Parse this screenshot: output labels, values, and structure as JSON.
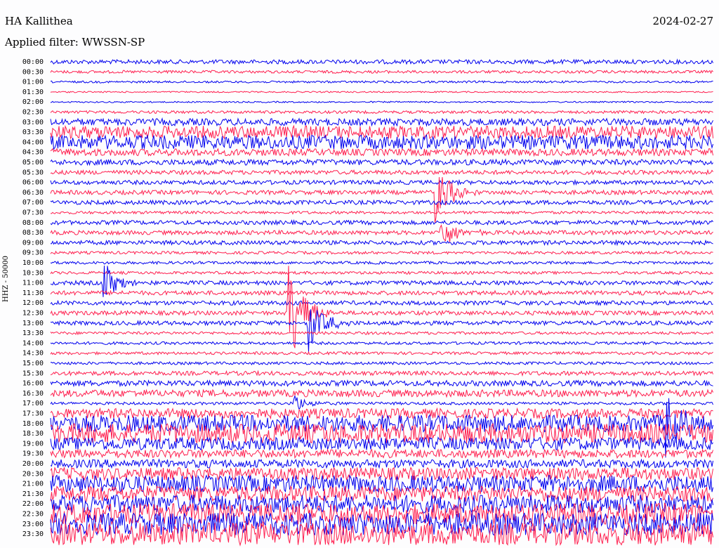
{
  "header": {
    "station": "HA Kallithea",
    "date": "2024-02-27",
    "filter": "Applied filter: WWSSN-SP"
  },
  "side_label": "HHZ - 50000",
  "colors": {
    "odd": "#0000ee",
    "even": "#ff1f4f"
  },
  "chart_data": {
    "type": "line",
    "title": "HA Kallithea",
    "subtitle": "Applied filter: WWSSN-SP",
    "ylabel": "HHZ - 50000",
    "categories": [
      "00:00",
      "00:30",
      "01:00",
      "01:30",
      "02:00",
      "02:30",
      "03:00",
      "03:30",
      "04:00",
      "04:30",
      "05:00",
      "05:30",
      "06:00",
      "06:30",
      "07:00",
      "07:30",
      "08:00",
      "08:30",
      "09:00",
      "09:30",
      "10:00",
      "10:30",
      "11:00",
      "11:30",
      "12:00",
      "12:30",
      "13:00",
      "13:30",
      "14:00",
      "14:30",
      "15:00",
      "15:30",
      "16:00",
      "16:30",
      "17:00",
      "17:30",
      "18:00",
      "18:30",
      "19:00",
      "19:30",
      "20:00",
      "20:30",
      "21:00",
      "21:30",
      "22:00",
      "22:30",
      "23:00",
      "23:30"
    ],
    "noise_level": [
      3,
      2,
      1.5,
      1,
      1,
      2,
      5,
      9,
      10,
      5,
      4,
      3,
      3,
      3,
      3,
      2,
      3,
      3,
      3,
      2,
      2,
      2,
      3,
      3,
      3,
      3,
      3,
      2,
      2,
      2,
      2,
      3,
      4,
      5,
      2,
      7,
      12,
      14,
      9,
      6,
      6,
      9,
      12,
      11,
      13,
      15,
      16,
      16
    ],
    "events": [
      {
        "row": 13,
        "pos": 0.58,
        "amp": 45
      },
      {
        "row": 17,
        "pos": 0.59,
        "amp": 25
      },
      {
        "row": 25,
        "pos": 0.36,
        "amp": 80
      },
      {
        "row": 26,
        "pos": 0.39,
        "amp": 40
      },
      {
        "row": 22,
        "pos": 0.08,
        "amp": 30
      },
      {
        "row": 36,
        "pos": 0.93,
        "amp": 45
      },
      {
        "row": 34,
        "pos": 0.37,
        "amp": 12
      }
    ]
  }
}
